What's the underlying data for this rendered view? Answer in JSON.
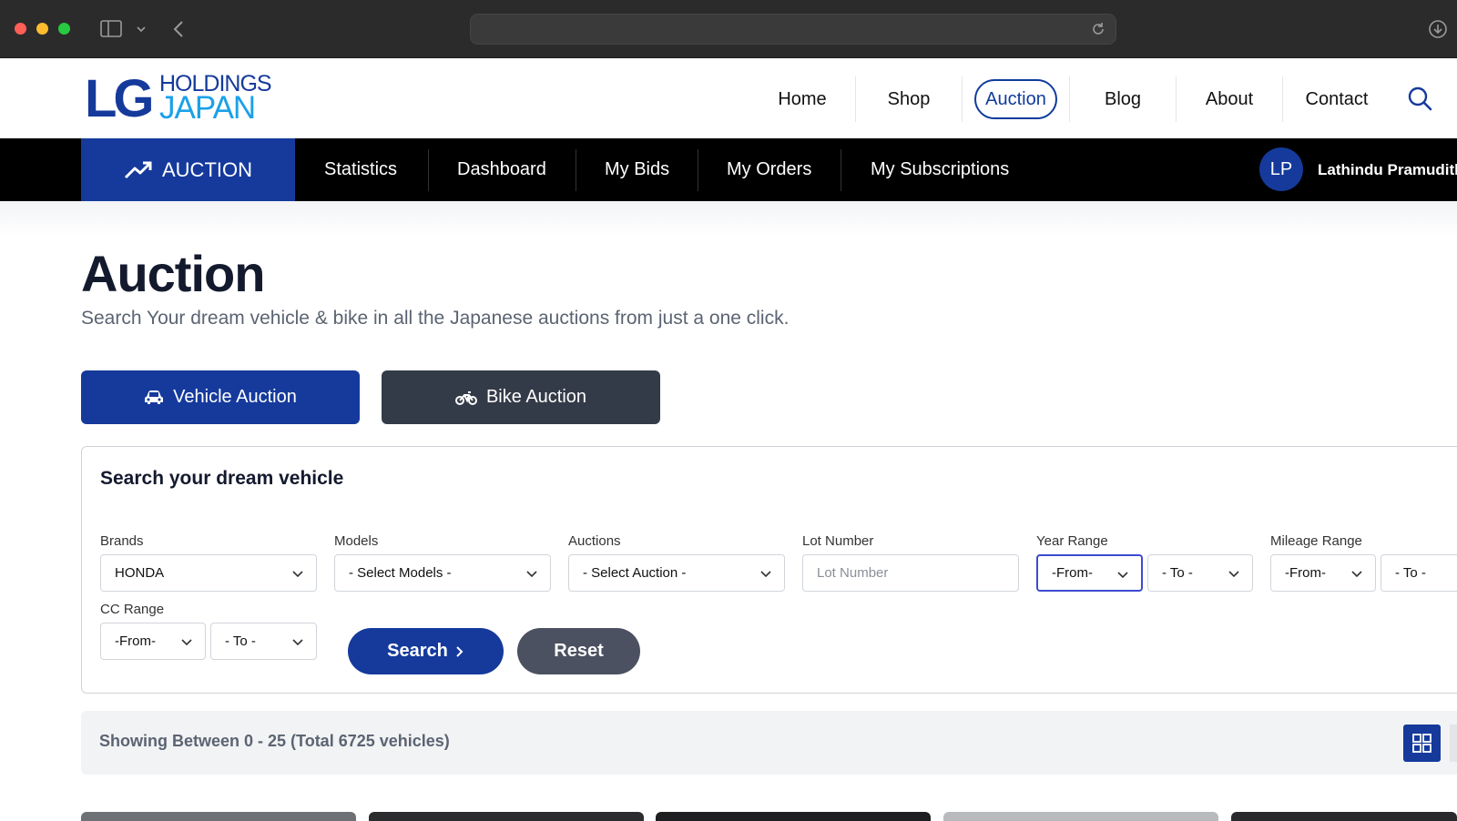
{
  "header": {
    "logo": {
      "line1": "HOLDINGS",
      "line2": "JAPAN",
      "mark": "LG"
    },
    "nav": [
      {
        "label": "Home"
      },
      {
        "label": "Shop"
      },
      {
        "label": "Auction",
        "active": true
      },
      {
        "label": "Blog"
      },
      {
        "label": "About"
      },
      {
        "label": "Contact"
      }
    ],
    "search_icon": "search-icon"
  },
  "subnav": {
    "active_tab": {
      "label": "AUCTION",
      "icon": "trending-up-icon"
    },
    "items": [
      {
        "label": "Statistics"
      },
      {
        "label": "Dashboard"
      },
      {
        "label": "My Bids"
      },
      {
        "label": "My Orders"
      },
      {
        "label": "My Subscriptions"
      }
    ],
    "user": {
      "initials": "LP",
      "name": "Lathindu Pramudith"
    }
  },
  "page": {
    "title": "Auction",
    "subtitle": "Search Your dream vehicle & bike in all the Japanese auctions from just a one click."
  },
  "tabs": {
    "vehicle": {
      "label": "Vehicle Auction",
      "icon": "car-icon"
    },
    "bike": {
      "label": "Bike Auction",
      "icon": "motorbike-icon"
    }
  },
  "search_panel": {
    "title": "Search your dream vehicle",
    "brands": {
      "label": "Brands",
      "value": "HONDA"
    },
    "models": {
      "label": "Models",
      "value": "- Select Models -"
    },
    "auctions": {
      "label": "Auctions",
      "value": "- Select Auction -"
    },
    "lot_number": {
      "label": "Lot Number",
      "placeholder": "Lot Number"
    },
    "year_range": {
      "label": "Year Range",
      "from": "-From-",
      "to": "- To -"
    },
    "mileage_range": {
      "label": "Mileage Range",
      "from": "-From-",
      "to": "- To -"
    },
    "cc_range": {
      "label": "CC Range",
      "from": "-From-",
      "to": "- To -"
    },
    "search_label": "Search",
    "reset_label": "Reset"
  },
  "results": {
    "text": "Showing Between 0 - 25 (Total 6725 vehicles)"
  },
  "colors": {
    "brand_blue": "#153a9c",
    "dark_button": "#343b48",
    "subnav_bg": "#000000"
  }
}
